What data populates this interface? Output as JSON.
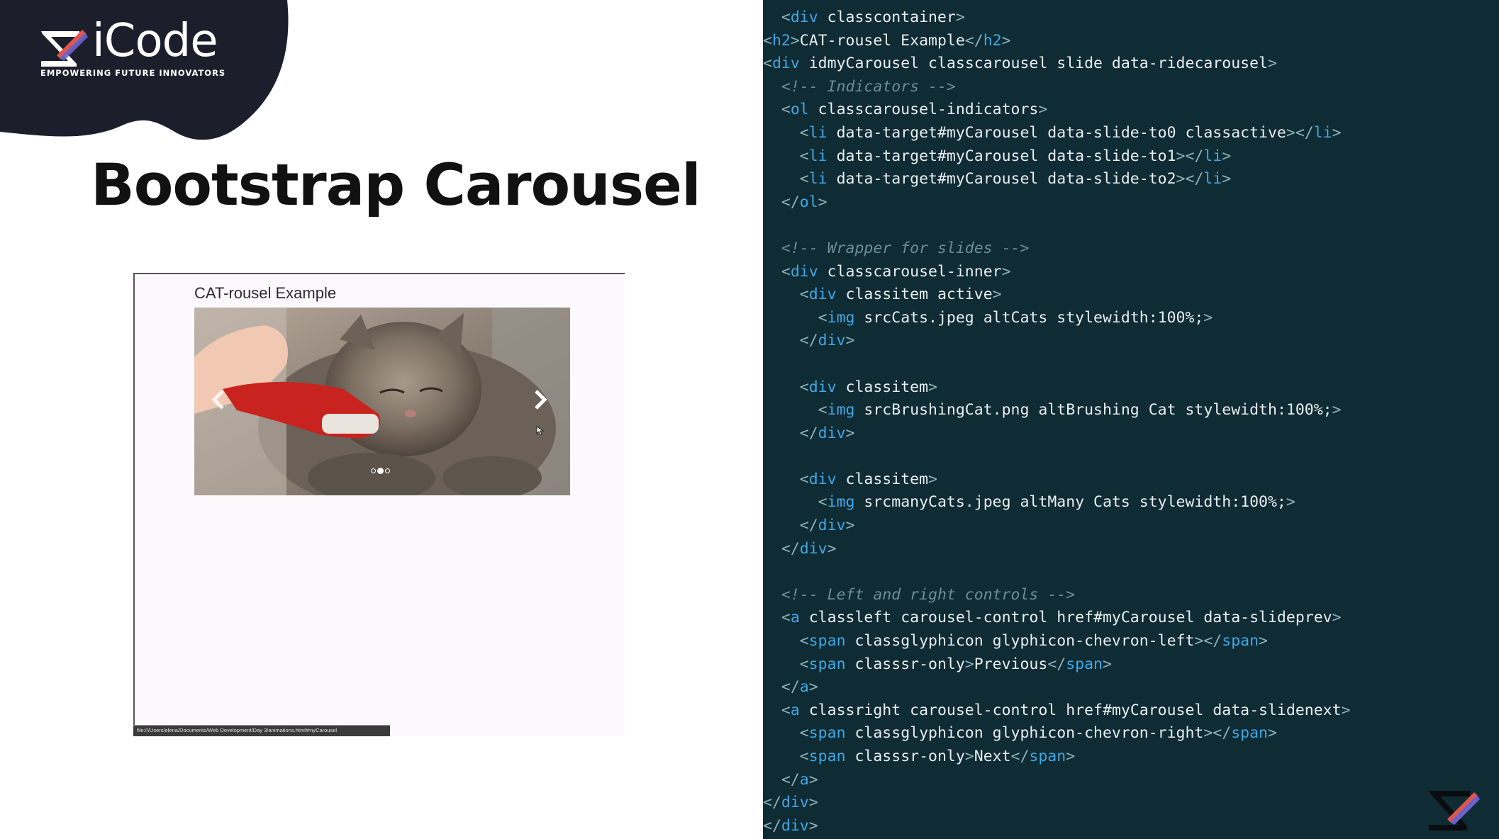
{
  "logo": {
    "name": "iCode",
    "tagline": "EMPOWERING FUTURE INNOVATORS"
  },
  "slide": {
    "title": "Bootstrap Carousel"
  },
  "browser": {
    "heading": "CAT-rousel Example",
    "carousel": {
      "image_alt": "Brushing Cat",
      "indicators": 3,
      "active_indicator": 2
    },
    "status_url": "file:///Users/elena/Documents/Web Development/Day 3/animations.html#myCarousel"
  },
  "code": {
    "lines": [
      "  <div class=\"container\">",
      "<h2>CAT-rousel Example</h2>",
      "<div id=\"myCarousel\" class=\"carousel slide\" data-ride=\"carousel\">",
      "  <!-- Indicators -->",
      "  <ol class=\"carousel-indicators\">",
      "    <li data-target=\"#myCarousel\" data-slide-to=\"0\" class=\"active\"></li>",
      "    <li data-target=\"#myCarousel\" data-slide-to=\"1\"></li>",
      "    <li data-target=\"#myCarousel\" data-slide-to=\"2\"></li>",
      "  </ol>",
      "",
      "  <!-- Wrapper for slides -->",
      "  <div class=\"carousel-inner\">",
      "    <div class=\"item active\">",
      "      <img src=\"Cats.jpeg\" alt=\"Cats\" style=\"width:100%;\">",
      "    </div>",
      "",
      "    <div class=\"item\">",
      "      <img src=\"BrushingCat.png\" alt=\"Brushing Cat\" style=\"width:100%;\">",
      "    </div>",
      "",
      "    <div class=\"item\">",
      "      <img src=\"manyCats.jpeg\" alt=\"Many Cats\" style=\"width:100%;\">",
      "    </div>",
      "  </div>",
      "",
      "  <!-- Left and right controls -->",
      "  <a class=\"left carousel-control\" href=\"#myCarousel\" data-slide=\"prev\">",
      "    <span class=\"glyphicon glyphicon-chevron-left\"></span>",
      "    <span class=\"sr-only\">Previous</span>",
      "  </a>",
      "  <a class=\"right carousel-control\" href=\"#myCarousel\" data-slide=\"next\">",
      "    <span class=\"glyphicon glyphicon-chevron-right\"></span>",
      "    <span class=\"sr-only\">Next</span>",
      "  </a>",
      "</div>",
      "</div>"
    ]
  },
  "colors": {
    "code_bg": "#0f2b33",
    "tag": "#3fa9e8",
    "string": "#e4f0f2",
    "comment": "#6d8d95",
    "css_prop": "#d9d35a",
    "logo_bg": "#1c1f2b"
  }
}
